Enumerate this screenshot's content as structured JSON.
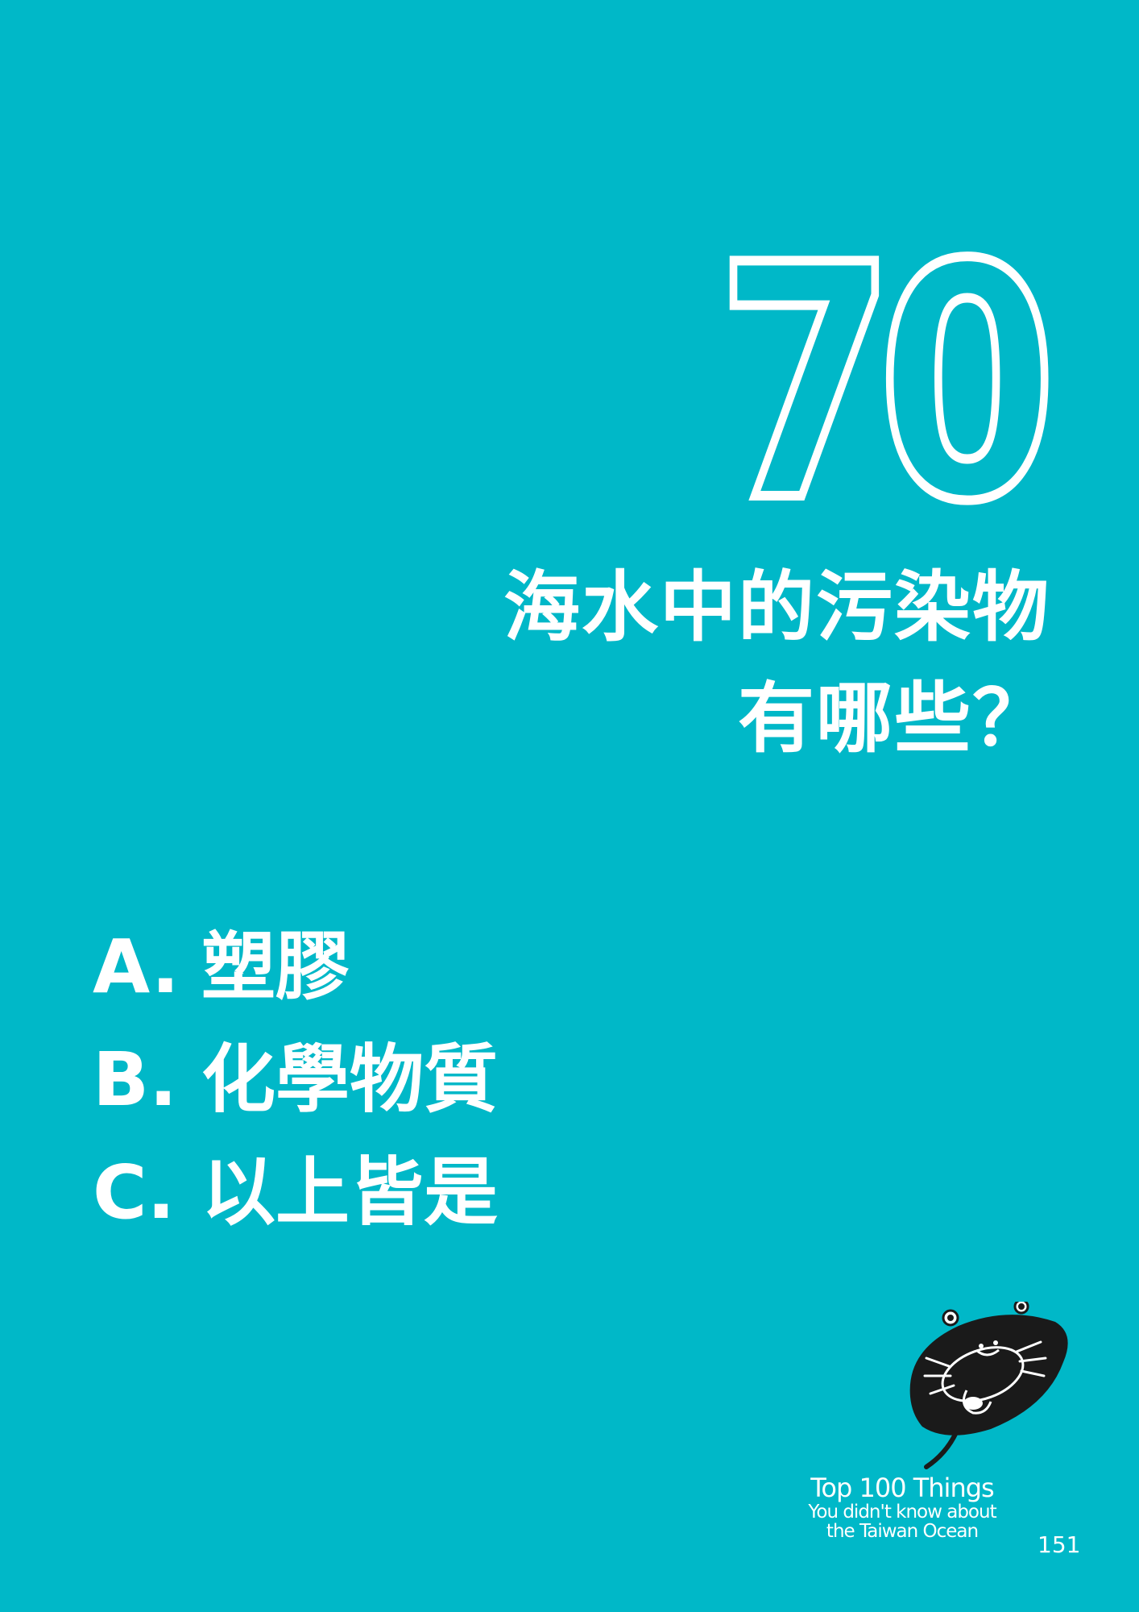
{
  "question": {
    "number": "70",
    "title_line1": "海水中的污染物",
    "title_line2": "有哪些？"
  },
  "options": [
    {
      "letter": "A.",
      "text": "塑膠"
    },
    {
      "letter": "B.",
      "text": "化學物質"
    },
    {
      "letter": "C.",
      "text": "以上皆是"
    }
  ],
  "footer": {
    "brand_line1": "Top 100 Things",
    "brand_line2": "You didn't know about",
    "brand_line3": "the Taiwan Ocean",
    "page_number": "151"
  },
  "colors": {
    "background": "#00b8c8",
    "text": "#ffffff",
    "mascot": "#1a1a1a"
  },
  "icons": {
    "mascot": "horseshoe-crab-icon"
  }
}
